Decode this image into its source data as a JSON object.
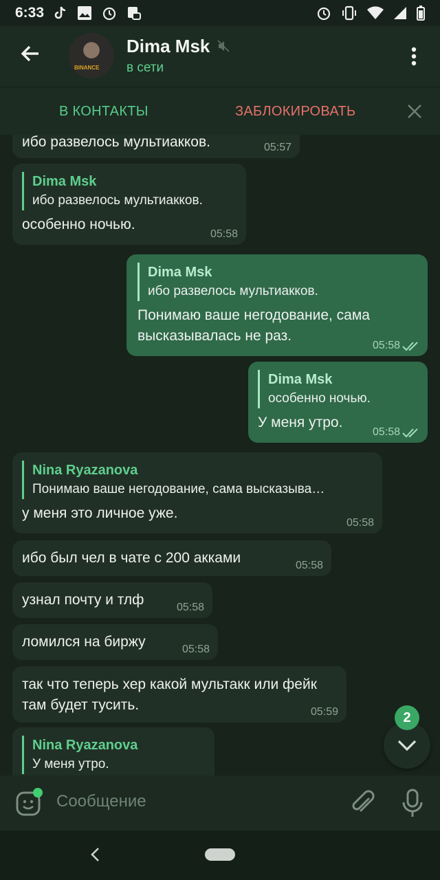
{
  "status_bar": {
    "time": "6:33"
  },
  "header": {
    "title": "Dima Msk",
    "subtitle": "в сети",
    "avatar_logo": "BINANCE"
  },
  "actions": {
    "add_contact": "В КОНТАКТЫ",
    "block": "ЗАБЛОКИРОВАТЬ"
  },
  "messages": [
    {
      "text": "ибо развелось мультиакков.",
      "time": "05:57"
    },
    {
      "reply_name": "Dima Msk",
      "reply_text": "ибо развелось мультиакков.",
      "text": "особенно ночью.",
      "time": "05:58"
    },
    {
      "reply_name": "Dima Msk",
      "reply_text": "ибо развелось мультиакков.",
      "text": "Понимаю ваше негодование, сама высказывалась не раз.",
      "time": "05:58"
    },
    {
      "reply_name": "Dima Msk",
      "reply_text": "особенно ночью.",
      "text": "У меня утро.",
      "time": "05:58"
    },
    {
      "reply_name": "Nina Ryazanova",
      "reply_text": "Понимаю ваше негодование, сама высказыва…",
      "text": "у меня это личное уже.",
      "time": "05:58"
    },
    {
      "text": "ибо был чел в чате с 200 акками",
      "time": "05:58"
    },
    {
      "text": "узнал почту и тлф",
      "time": "05:58"
    },
    {
      "text": "ломился на биржу",
      "time": "05:58"
    },
    {
      "text": "так что теперь хер какой мультакк или фейк там будет тусить.",
      "time": "05:59"
    },
    {
      "reply_name": "Nina Ryazanova",
      "reply_text": "У меня утро."
    }
  ],
  "unread_badge": "2",
  "input": {
    "placeholder": "Сообщение"
  },
  "icons": {
    "back": "arrow-left-icon",
    "mute": "muted-speaker-icon",
    "menu": "more-vert-icon",
    "close": "close-icon",
    "scroll_down": "chevron-down-icon",
    "emoji": "sticker-emoji-icon",
    "attach": "paperclip-icon",
    "mic": "microphone-icon"
  },
  "colors": {
    "accent": "#5fcf8e",
    "block_red": "#e8706a",
    "outgoing_bubble": "#2f6a49",
    "incoming_bubble": "#213026"
  }
}
